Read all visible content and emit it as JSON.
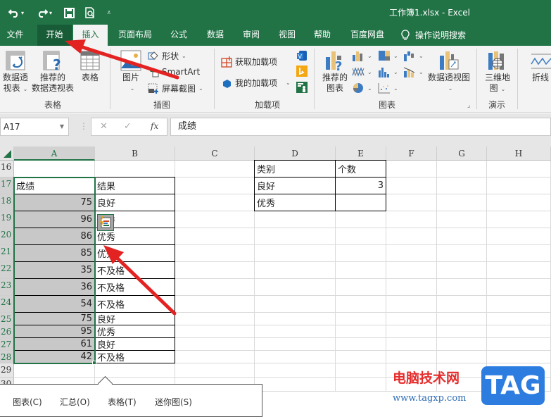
{
  "window": {
    "title": "工作簿1.xlsx  -  Excel"
  },
  "quick_access": {
    "undo_icon": "undo-icon",
    "redo_icon": "redo-icon",
    "save_icon": "save-icon",
    "print_preview_icon": "print-preview-icon",
    "customize_icon": "customize-icon"
  },
  "tabs": [
    {
      "label": "文件"
    },
    {
      "label": "开始"
    },
    {
      "label": "插入"
    },
    {
      "label": "页面布局"
    },
    {
      "label": "公式"
    },
    {
      "label": "数据"
    },
    {
      "label": "审阅"
    },
    {
      "label": "视图"
    },
    {
      "label": "帮助"
    },
    {
      "label": "百度网盘"
    },
    {
      "label": "操作说明搜索"
    }
  ],
  "ribbon": {
    "tables": {
      "label": "表格",
      "pivot_table": [
        "数据透",
        "视表"
      ],
      "recommended_pivot": [
        "推荐的",
        "数据透视表"
      ],
      "table": "表格"
    },
    "illustrations": {
      "label": "插图",
      "pictures": "图片",
      "shapes": "形状",
      "smartart": "SmartArt",
      "screenshot": "屏幕截图"
    },
    "addins": {
      "label": "加载项",
      "get_addins": "获取加载项",
      "my_addins": "我的加载项"
    },
    "charts": {
      "label": "图表",
      "recommended_charts": [
        "推荐的",
        "图表"
      ],
      "pivot_chart": "数据透视图"
    },
    "tours": {
      "label": "演示",
      "map3d": [
        "三维地",
        "图"
      ]
    },
    "sparklines": {
      "line": "折线"
    }
  },
  "formula_bar": {
    "name_box": "A17",
    "cancel": "✕",
    "enter": "✓",
    "fx": "fx",
    "content": "成绩"
  },
  "sheet": {
    "columns": [
      "A",
      "B",
      "C",
      "D",
      "E",
      "F",
      "G",
      "H"
    ],
    "rows": [
      "16",
      "17",
      "18",
      "19",
      "20",
      "21",
      "22",
      "23",
      "24",
      "25",
      "26",
      "27",
      "28",
      "29",
      "30"
    ],
    "table1": {
      "header": [
        "成绩",
        "结果"
      ],
      "rows": [
        [
          "75",
          "良好"
        ],
        [
          "96",
          "优秀"
        ],
        [
          "86",
          "优秀"
        ],
        [
          "85",
          "优秀"
        ],
        [
          "35",
          "不及格"
        ],
        [
          "36",
          "不及格"
        ],
        [
          "54",
          "不及格"
        ],
        [
          "75",
          "良好"
        ],
        [
          "95",
          "优秀"
        ],
        [
          "61",
          "良好"
        ],
        [
          "42",
          "不及格"
        ]
      ]
    },
    "table2": {
      "header": [
        "类别",
        "个数"
      ],
      "rows": [
        [
          "良好",
          "3"
        ],
        [
          "优秀",
          ""
        ]
      ]
    }
  },
  "quick_analysis": {
    "items": [
      "图表(C)",
      "汇总(O)",
      "表格(T)",
      "迷你图(S)"
    ]
  },
  "watermark": {
    "brand": "电脑技术网",
    "url": "www.tagxp.com",
    "badge": "TAG"
  }
}
